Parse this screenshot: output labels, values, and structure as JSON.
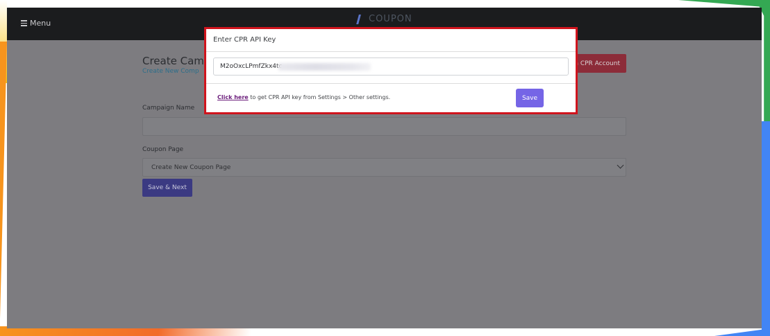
{
  "navbar": {
    "menu_label": "Menu",
    "brand": "COUPON"
  },
  "page": {
    "title": "Create Cam",
    "subtitle": "Create New Comp",
    "switch_button": "ch CPR Account",
    "campaign_name_label": "Campaign Name",
    "campaign_name_value": "",
    "coupon_page_label": "Coupon Page",
    "coupon_page_selected": "Create New Coupon Page",
    "save_next_button": "Save & Next"
  },
  "modal": {
    "title": "Enter CPR API Key",
    "api_key_value": "M2oOxcLPmfZkx4tc",
    "help_link": "Click here",
    "help_text": " to get CPR API key from Settings > Other settings.",
    "save_button": "Save"
  },
  "colors": {
    "modal_border": "#d0141d",
    "save_button": "#7565e6",
    "navbar": "#1b1c1e",
    "switch_button": "#8c2c39"
  }
}
